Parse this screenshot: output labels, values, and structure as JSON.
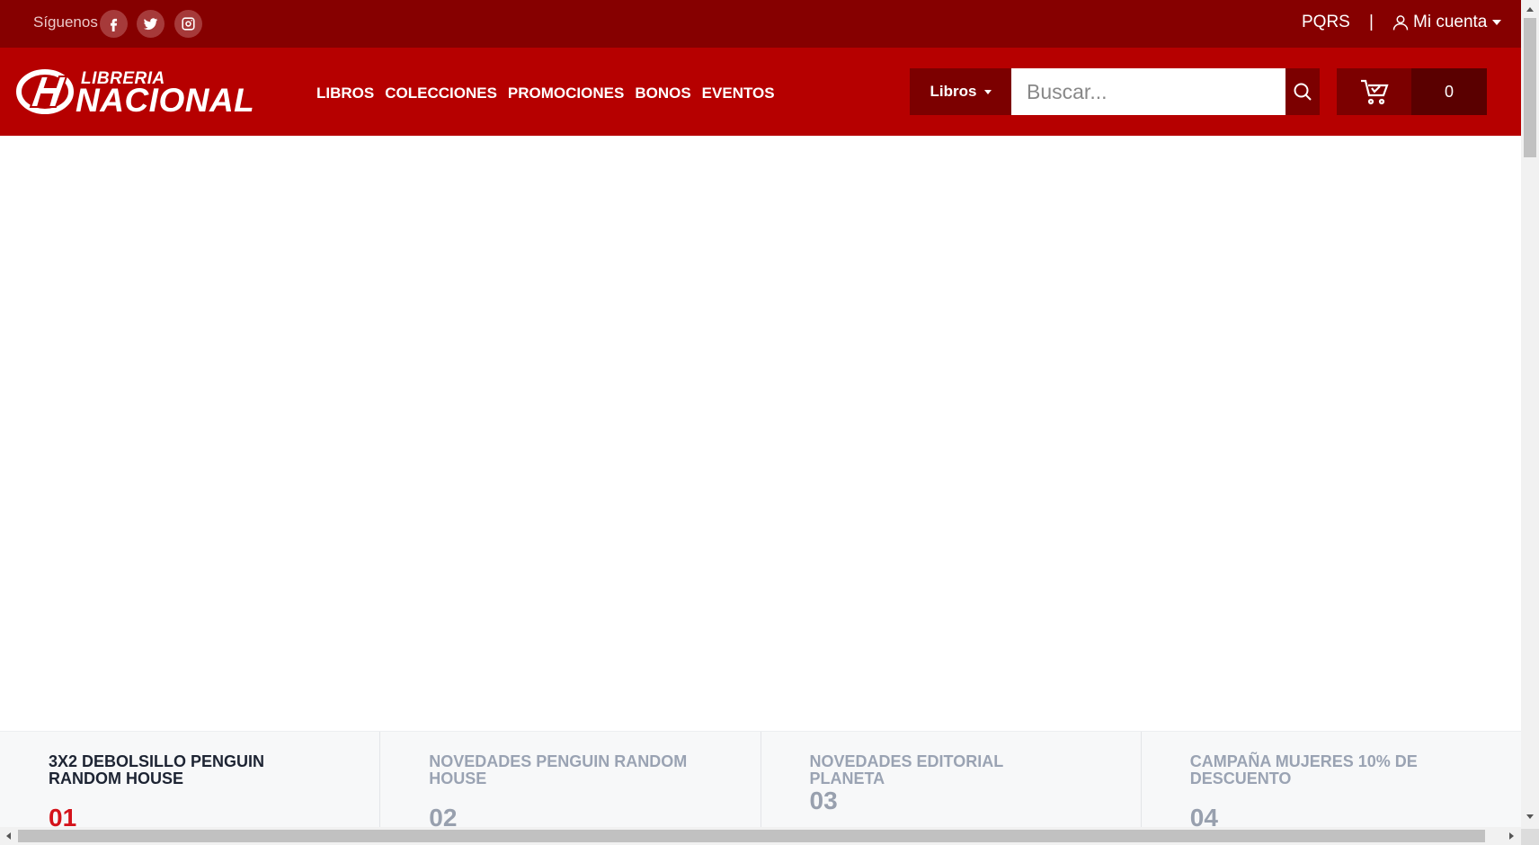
{
  "topbar": {
    "follow_label": "Síguenos",
    "social": [
      "facebook-icon",
      "twitter-icon",
      "instagram-icon"
    ],
    "pqrs": "PQRS",
    "separator": "|",
    "account_label": "Mi cuenta"
  },
  "header": {
    "logo_small": "LIBRERIA",
    "logo_big": "NACIONAL",
    "nav": [
      "LIBROS",
      "COLECCIONES",
      "PROMOCIONES",
      "BONOS",
      "EVENTOS"
    ],
    "category_select": "Libros",
    "search_placeholder": "Buscar...",
    "cart_count": "0"
  },
  "tabs": [
    {
      "title": "3X2 DEBOLSILLO PENGUIN RANDOM HOUSE",
      "number": "01",
      "active": true
    },
    {
      "title": "NOVEDADES PENGUIN RANDOM HOUSE",
      "number": "02",
      "active": false
    },
    {
      "title": "NOVEDADES EDITORIAL PLANETA",
      "number": "03",
      "active": false
    },
    {
      "title": "CAMPAÑA MUJERES 10% DE DESCUENTO",
      "number": "04",
      "active": false
    }
  ],
  "colors": {
    "topbar_bg": "#860000",
    "header_bg": "#b60000",
    "active_number": "#d4131b"
  }
}
